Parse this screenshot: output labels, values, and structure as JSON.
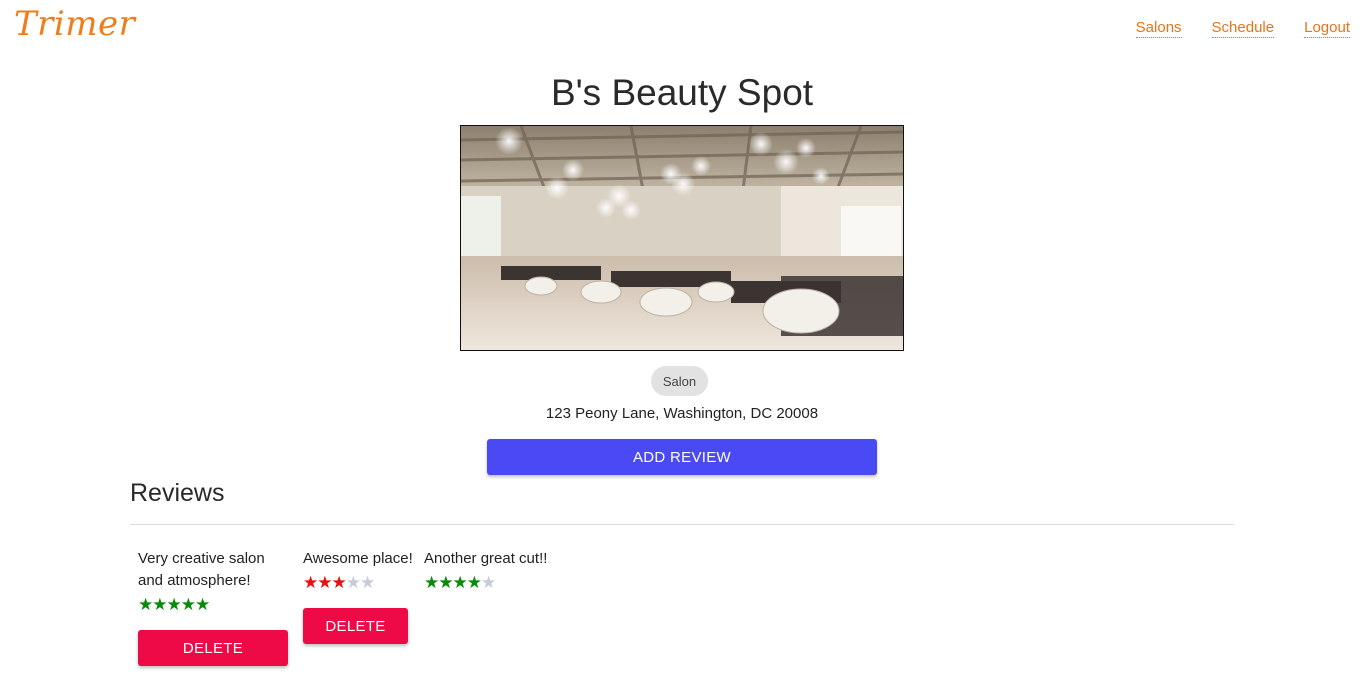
{
  "app": {
    "logo": "Trimer"
  },
  "nav": {
    "salons": "Salons",
    "schedule": "Schedule",
    "logout": "Logout"
  },
  "salon": {
    "name": "B's Beauty Spot",
    "category": "Salon",
    "address": "123 Peony Lane, Washington, DC 20008",
    "add_review_label": "ADD REVIEW"
  },
  "reviews": {
    "heading": "Reviews",
    "items": [
      {
        "text": "Very creative salon and atmosphere!",
        "rating": 5,
        "max": 5,
        "star_color": "#0a8a0a",
        "delete_label": "DELETE"
      },
      {
        "text": "Awesome place!",
        "rating": 3,
        "max": 5,
        "star_color": "#e81010",
        "delete_label": "DELETE"
      },
      {
        "text": "Another great cut!!",
        "rating": 4,
        "max": 5,
        "star_color": "#0a8a0a"
      }
    ]
  },
  "colors": {
    "brand": "#f07d1a",
    "primary_button": "#4a4af5",
    "danger_button": "#ee0a47",
    "star_empty": "#c5ccd8"
  }
}
